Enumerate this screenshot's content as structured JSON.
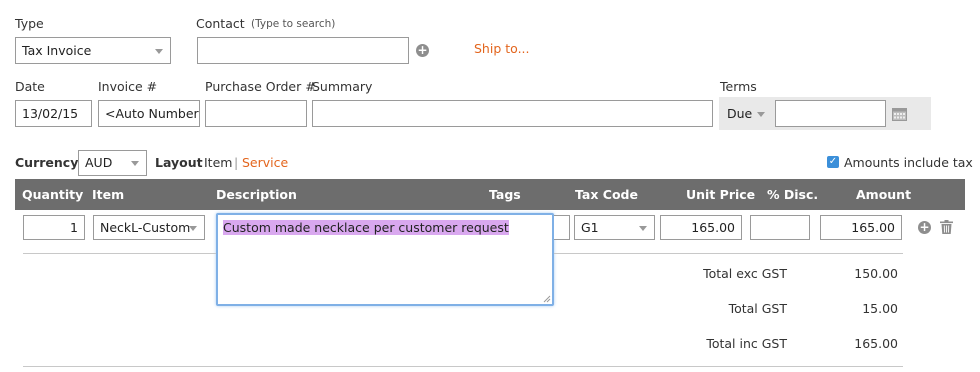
{
  "type": {
    "label": "Type",
    "value": "Tax Invoice"
  },
  "contact": {
    "label": "Contact",
    "hint": "(Type to search)",
    "value": "",
    "ship_to": "Ship to..."
  },
  "date": {
    "label": "Date",
    "value": "13/02/15"
  },
  "invoice": {
    "label": "Invoice #",
    "value": "<Auto Number>"
  },
  "purchase_order": {
    "label": "Purchase Order #",
    "value": ""
  },
  "summary": {
    "label": "Summary",
    "value": ""
  },
  "terms": {
    "label": "Terms",
    "value": "Due",
    "days": ""
  },
  "currency": {
    "label": "Currency",
    "value": "AUD"
  },
  "layout": {
    "label": "Layout",
    "item": "Item",
    "separator": "|",
    "service": "Service"
  },
  "amounts_include_tax": {
    "label": "Amounts include tax",
    "checked": true
  },
  "table": {
    "headers": {
      "quantity": "Quantity",
      "item": "Item",
      "description": "Description",
      "tags": "Tags",
      "tax_code": "Tax Code",
      "unit_price": "Unit Price",
      "disc": "% Disc.",
      "amount": "Amount"
    },
    "row": {
      "quantity": "1",
      "item": "NeckL-Custom",
      "description": "Custom made necklace per customer request",
      "tags": "",
      "tax_code": "G1",
      "unit_price": "165.00",
      "disc": "",
      "amount": "165.00"
    }
  },
  "totals": {
    "exc_label": "Total exc GST",
    "exc_value": "150.00",
    "gst_label": "Total GST",
    "gst_value": "15.00",
    "inc_label": "Total inc GST",
    "inc_value": "165.00"
  },
  "colors": {
    "accent": "#e3651d",
    "header_bar": "#6d6d6d",
    "focus": "#7fb0e6",
    "highlight": "#d9a8ef"
  }
}
